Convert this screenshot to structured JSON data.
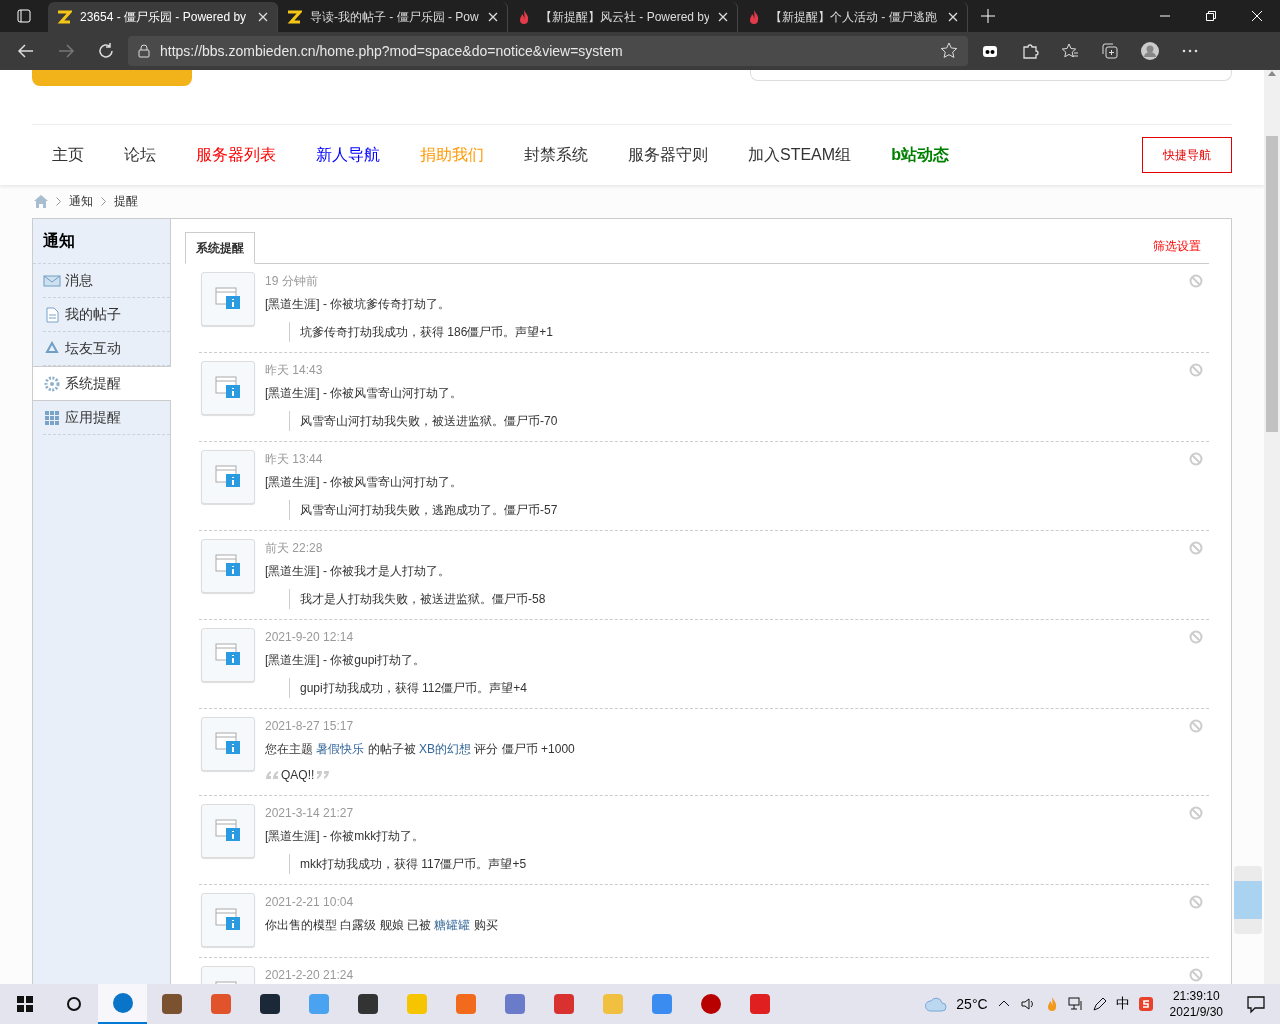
{
  "browser": {
    "tabs": [
      {
        "title": "23654 - 僵尸乐园 - Powered by",
        "selected": true
      },
      {
        "title": "导读-我的帖子 - 僵尸乐园 - Pow",
        "selected": false
      },
      {
        "title": "【新提醒】风云社 - Powered by",
        "selected": false
      },
      {
        "title": "【新提醒】个人活动 - 僵尸逃跑",
        "selected": false
      }
    ],
    "url": "https://bbs.zombieden.cn/home.php?mod=space&do=notice&view=system"
  },
  "nav": {
    "items": [
      {
        "label": "主页",
        "color": "#333333",
        "bold": false
      },
      {
        "label": "论坛",
        "color": "#333333",
        "bold": false
      },
      {
        "label": "服务器列表",
        "color": "#ff0000",
        "bold": false
      },
      {
        "label": "新人导航",
        "color": "#0000ff",
        "bold": false
      },
      {
        "label": "捐助我们",
        "color": "#ff9900",
        "bold": false
      },
      {
        "label": "封禁系统",
        "color": "#333333",
        "bold": false
      },
      {
        "label": "服务器守则",
        "color": "#333333",
        "bold": false
      },
      {
        "label": "加入STEAM组",
        "color": "#333333",
        "bold": false
      },
      {
        "label": "b站动态",
        "color": "#008000",
        "bold": true
      }
    ],
    "quick_button": "快捷导航"
  },
  "breadcrumb": [
    "通知",
    "提醒"
  ],
  "sidebar": {
    "title": "通知",
    "items": [
      {
        "label": "消息",
        "selected": false
      },
      {
        "label": "我的帖子",
        "selected": false
      },
      {
        "label": "坛友互动",
        "selected": false
      },
      {
        "label": "系统提醒",
        "selected": true
      },
      {
        "label": "应用提醒",
        "selected": false
      }
    ]
  },
  "tabs": [
    {
      "label": "系统提醒",
      "selected": true
    }
  ],
  "filter_link": "筛选设置",
  "notices": [
    {
      "time": "19 分钟前",
      "body": [
        {
          "kind": "text",
          "text": "[黑道生涯] - 你被坑爹传奇打劫了。"
        }
      ],
      "detail": {
        "kind": "quote",
        "text": "坑爹传奇打劫我成功，获得 186僵尸币。声望+1"
      }
    },
    {
      "time": "昨天 14:43",
      "body": [
        {
          "kind": "text",
          "text": "[黑道生涯] - 你被风雪寄山河打劫了。"
        }
      ],
      "detail": {
        "kind": "quote",
        "text": "风雪寄山河打劫我失败，被送进监狱。僵尸币-70"
      }
    },
    {
      "time": "昨天 13:44",
      "body": [
        {
          "kind": "text",
          "text": "[黑道生涯] - 你被风雪寄山河打劫了。"
        }
      ],
      "detail": {
        "kind": "quote",
        "text": "风雪寄山河打劫我失败，逃跑成功了。僵尸币-57"
      }
    },
    {
      "time": "前天 22:28",
      "body": [
        {
          "kind": "text",
          "text": "[黑道生涯] - 你被我才是人打劫了。"
        }
      ],
      "detail": {
        "kind": "quote",
        "text": "我才是人打劫我失败，被送进监狱。僵尸币-58"
      }
    },
    {
      "time": "2021-9-20 12:14",
      "body": [
        {
          "kind": "text",
          "text": "[黑道生涯] - 你被gupi打劫了。"
        }
      ],
      "detail": {
        "kind": "quote",
        "text": "gupi打劫我成功，获得 112僵尸币。声望+4"
      }
    },
    {
      "time": "2021-8-27 15:17",
      "body": [
        {
          "kind": "text",
          "text": "您在主题 "
        },
        {
          "kind": "link",
          "text": "暑假快乐"
        },
        {
          "kind": "text",
          "text": " 的帖子被 "
        },
        {
          "kind": "link",
          "text": "XB的幻想"
        },
        {
          "kind": "text",
          "text": " 评分 僵尸币 +1000"
        }
      ],
      "detail": {
        "kind": "comment",
        "text": "QAQ!!"
      }
    },
    {
      "time": "2021-3-14 21:27",
      "body": [
        {
          "kind": "text",
          "text": "[黑道生涯] - 你被mkk打劫了。"
        }
      ],
      "detail": {
        "kind": "quote",
        "text": "mkk打劫我成功，获得 117僵尸币。声望+5"
      }
    },
    {
      "time": "2021-2-21 10:04",
      "body": [
        {
          "kind": "text",
          "text": "你出售的模型 白露级 舰娘 已被 "
        },
        {
          "kind": "link",
          "text": "糖罐罐"
        },
        {
          "kind": "text",
          "text": " 购买"
        }
      ]
    },
    {
      "time": "2021-2-20 21:24"
    }
  ],
  "taskbar": {
    "weather": "25°C",
    "ime": "中",
    "time": "21:39:10",
    "date": "2021/9/30"
  }
}
